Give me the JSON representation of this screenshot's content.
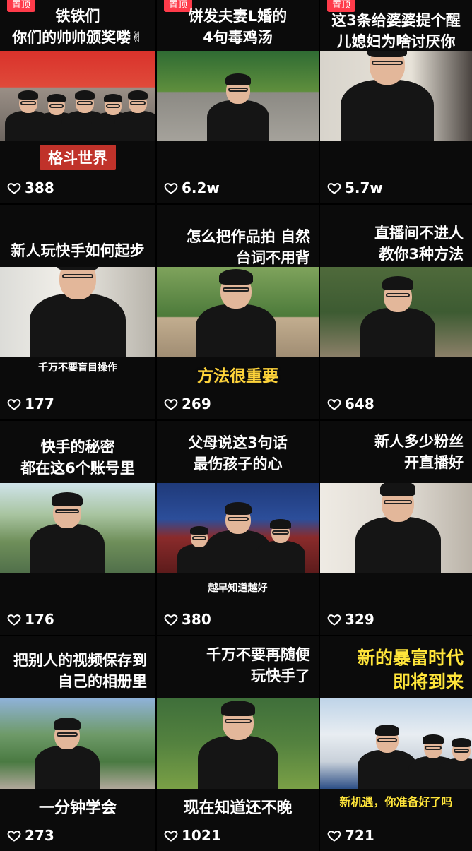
{
  "pinned_label": "置顶",
  "tiles": [
    {
      "caption": "铁铁们\n你们的帅帅颁奖喽✌",
      "banner": "格斗世界",
      "likes": "388",
      "pinned": true
    },
    {
      "caption": "饼发夫妻L婚的\n4句毒鸡汤",
      "likes": "6.2w",
      "pinned": true
    },
    {
      "caption": "这3条给婆婆提个醒\n儿媳妇为啥讨厌你",
      "likes": "5.7w",
      "pinned": true
    },
    {
      "caption": "新人玩快手如何起步",
      "mid_text": "千万不要盲目操作",
      "likes": "177"
    },
    {
      "caption": "怎么把作品拍 自然\n台词不用背",
      "banner": "方法很重要",
      "likes": "269"
    },
    {
      "caption": "直播间不进人\n教你3种方法",
      "likes": "648"
    },
    {
      "caption": "快手的秘密\n都在这6个账号里",
      "likes": "176"
    },
    {
      "caption": "父母说这3句话\n最伤孩子的心",
      "mid_text": "越早知道越好",
      "likes": "380"
    },
    {
      "caption": "新人多少粉丝\n开直播好",
      "likes": "329"
    },
    {
      "caption": "把别人的视频保存到\n自己的相册里",
      "banner": "一分钟学会",
      "likes": "273"
    },
    {
      "caption": "千万不要再随便\n玩快手了",
      "banner": "现在知道还不晚",
      "likes": "1021"
    },
    {
      "caption": "新的暴富时代\n即将到来",
      "mid_text": "新机遇，你准备好了吗",
      "likes": "721"
    }
  ],
  "colors": {
    "pinned": "#ff3b4a",
    "banner_red": "#c0322a",
    "yellow_text": "#ffe53a",
    "background": "#000000"
  }
}
